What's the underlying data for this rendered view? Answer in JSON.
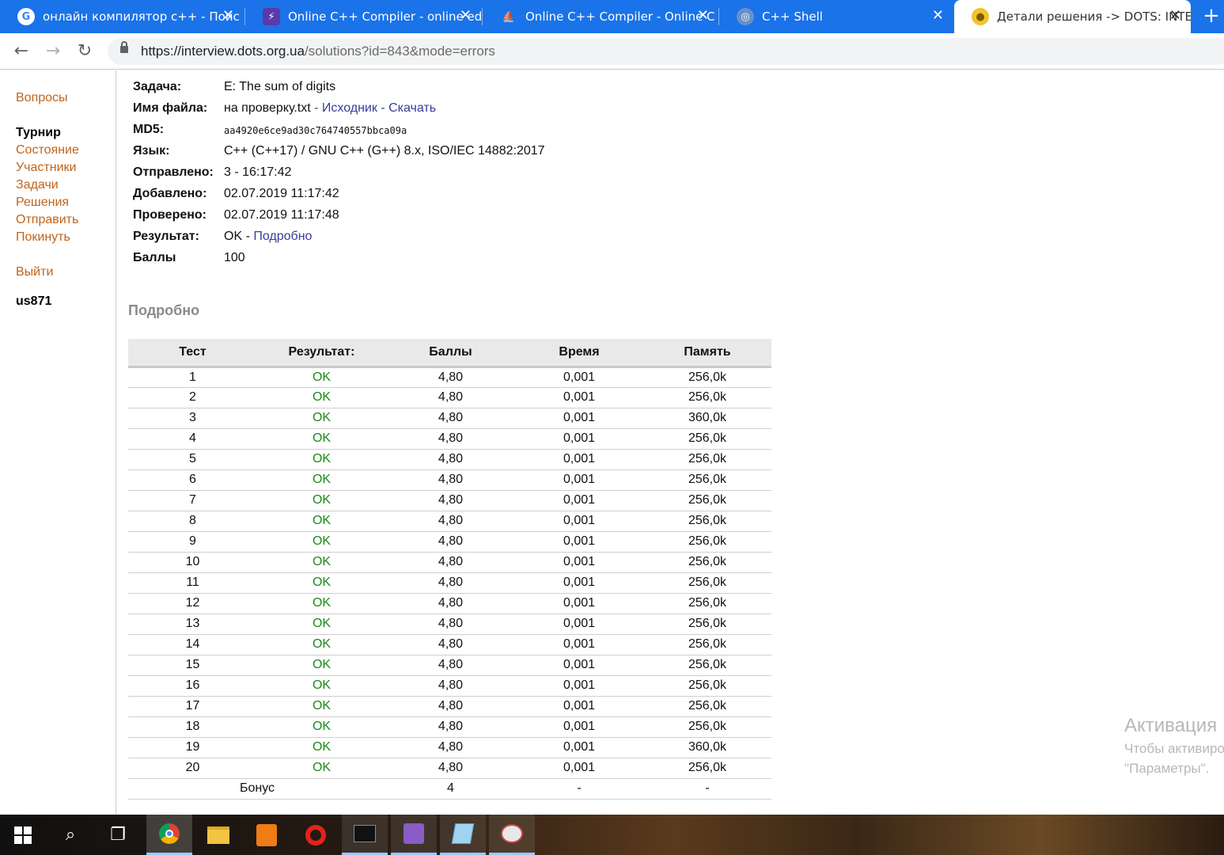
{
  "browser": {
    "tabs": [
      {
        "title": "онлайн компилятор с++ - Поис",
        "icon": "google-icon",
        "active": false
      },
      {
        "title": "Online C++ Compiler - online ed",
        "icon": "lightning-icon",
        "active": false
      },
      {
        "title": "Online C++ Compiler - Online C",
        "icon": "ship-icon",
        "active": false
      },
      {
        "title": "C++ Shell",
        "icon": "shell-icon",
        "active": false
      },
      {
        "title": "Детали решения -> DOTS: INTE",
        "icon": "dots-icon",
        "active": true
      }
    ],
    "new_tab_label": "+",
    "url_host": "https://interview.dots.org.ua",
    "url_path": "/solutions?id=843&mode=errors"
  },
  "sidebar": {
    "questions": "Вопросы",
    "tournament_heading": "Турнир",
    "links": [
      "Состояние",
      "Участники",
      "Задачи",
      "Решения",
      "Отправить",
      "Покинуть"
    ],
    "logout": "Выйти",
    "username": "us871"
  },
  "solution": {
    "task_label": "Задача:",
    "task_value": "E: The sum of digits",
    "file_label": "Имя файла:",
    "file_name": "на проверку.txt",
    "file_sep1": " - ",
    "file_source": "Исходник",
    "file_sep2": " - ",
    "file_download": "Скачать",
    "md5_label": "MD5:",
    "md5_value": "aa4920e6ce9ad30c764740557bbca09a",
    "lang_label": "Язык:",
    "lang_value": "C++ (C++17) / GNU C++ (G++) 8.x, ISO/IEC 14882:2017",
    "sent_label": "Отправлено:",
    "sent_value": "3 - 16:17:42",
    "added_label": "Добавлено:",
    "added_value": "02.07.2019 11:17:42",
    "checked_label": "Проверено:",
    "checked_value": "02.07.2019 11:17:48",
    "result_label": "Результат:",
    "result_value": "OK",
    "result_sep": " - ",
    "result_link": "Подробно",
    "score_label": "Баллы",
    "score_value": "100"
  },
  "details": {
    "title": "Подробно",
    "headers": [
      "Тест",
      "Результат:",
      "Баллы",
      "Время",
      "Память"
    ],
    "rows": [
      [
        "1",
        "OK",
        "4,80",
        "0,001",
        "256,0k"
      ],
      [
        "2",
        "OK",
        "4,80",
        "0,001",
        "256,0k"
      ],
      [
        "3",
        "OK",
        "4,80",
        "0,001",
        "360,0k"
      ],
      [
        "4",
        "OK",
        "4,80",
        "0,001",
        "256,0k"
      ],
      [
        "5",
        "OK",
        "4,80",
        "0,001",
        "256,0k"
      ],
      [
        "6",
        "OK",
        "4,80",
        "0,001",
        "256,0k"
      ],
      [
        "7",
        "OK",
        "4,80",
        "0,001",
        "256,0k"
      ],
      [
        "8",
        "OK",
        "4,80",
        "0,001",
        "256,0k"
      ],
      [
        "9",
        "OK",
        "4,80",
        "0,001",
        "256,0k"
      ],
      [
        "10",
        "OK",
        "4,80",
        "0,001",
        "256,0k"
      ],
      [
        "11",
        "OK",
        "4,80",
        "0,001",
        "256,0k"
      ],
      [
        "12",
        "OK",
        "4,80",
        "0,001",
        "256,0k"
      ],
      [
        "13",
        "OK",
        "4,80",
        "0,001",
        "256,0k"
      ],
      [
        "14",
        "OK",
        "4,80",
        "0,001",
        "256,0k"
      ],
      [
        "15",
        "OK",
        "4,80",
        "0,001",
        "256,0k"
      ],
      [
        "16",
        "OK",
        "4,80",
        "0,001",
        "256,0k"
      ],
      [
        "17",
        "OK",
        "4,80",
        "0,001",
        "256,0k"
      ],
      [
        "18",
        "OK",
        "4,80",
        "0,001",
        "256,0k"
      ],
      [
        "19",
        "OK",
        "4,80",
        "0,001",
        "360,0k"
      ],
      [
        "20",
        "OK",
        "4,80",
        "0,001",
        "256,0k"
      ]
    ],
    "bonus": {
      "label": "Бонус",
      "score": "4",
      "time": "-",
      "memory": "-"
    }
  },
  "watermark": {
    "line1": "Активация",
    "line2": "Чтобы активиро",
    "line3": "\"Параметры\"."
  },
  "colors": {
    "tab_strip": "#1a73e8",
    "sidebar_link": "#c0641a",
    "link": "#3b3b9a",
    "ok": "#1a8a1a",
    "header_bg": "#e9e9e9"
  },
  "taskbar": {
    "items": [
      "windows-start-icon",
      "search-icon",
      "task-view-icon",
      "chrome-icon",
      "file-explorer-icon",
      "pdf-icon",
      "opera-icon",
      "terminal-icon",
      "visual-studio-icon",
      "notepad-icon",
      "paint-icon"
    ]
  }
}
